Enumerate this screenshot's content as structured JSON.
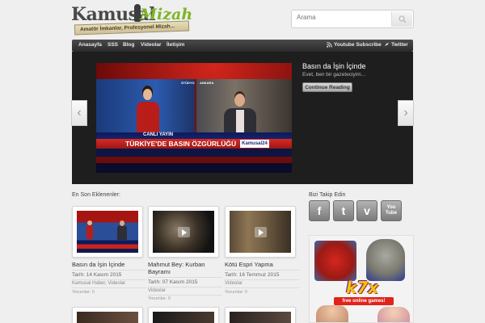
{
  "header": {
    "logo_word": "Kamusal",
    "logo_script": "Mizah",
    "logo_tagline": "Amatör İmkanlar, Profesyonel Mizah...",
    "search_placeholder": "Arama"
  },
  "nav": {
    "items": [
      "Anasayfa",
      "SSS",
      "Blog",
      "Videolar",
      "İletişim"
    ],
    "youtube": "Youtube Subscribe",
    "twitter": "Twitter"
  },
  "slider": {
    "title": "Basın da İşin İçinde",
    "excerpt": "Evet, ben bir gazeteciyim...",
    "button": "Continue Reading",
    "image_live": "CANLI YAYIN",
    "image_headline": "TÜRKİYE'DE BASIN ÖZGÜRLÜĞÜ",
    "image_channel": "Kamusal24",
    "image_tag1": "STÜDYO",
    "image_tag2": "ANKARA",
    "prev_arrow": "‹",
    "next_arrow": "›"
  },
  "latest": {
    "title": "En Son Eklenenler:",
    "cards": [
      {
        "title": "Basın da İşin İçinde",
        "date": "Tarih: 14 Kasım 2015",
        "category": "Kamusal Haber, Videolar",
        "comments": "Yorumlar: 0"
      },
      {
        "title": "Mahmut Bey: Kurban Bayramı",
        "date": "Tarih: 07 Kasım 2015",
        "category": "Videolar",
        "comments": "Yorumlar: 0"
      },
      {
        "title": "Kötü Espri Yapma",
        "date": "Tarih: 16 Temmuz 2015",
        "category": "Videolar",
        "comments": "Yorumlar: 0"
      }
    ]
  },
  "sidebar": {
    "follow_title": "Bizi Takip Edin",
    "social": [
      {
        "icon": "facebook-icon",
        "glyph": "f"
      },
      {
        "icon": "twitter-icon",
        "glyph": "t"
      },
      {
        "icon": "vimeo-icon",
        "glyph": "v"
      },
      {
        "icon": "youtube-icon",
        "glyph": "You Tube"
      }
    ],
    "ad_brand": "k7x",
    "ad_tagline": "free online games!"
  },
  "colors": {
    "nav_bg": "#2b2b2b",
    "slider_bg": "#1e1e1e",
    "logo_green": "#7fb526",
    "page_bg": "#efefef"
  }
}
